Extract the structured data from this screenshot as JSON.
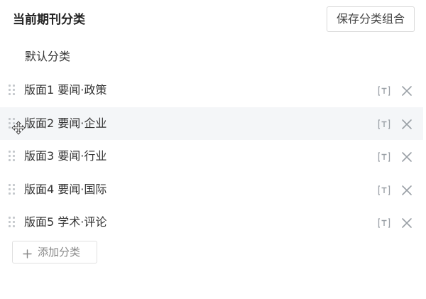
{
  "header": {
    "title": "当前期刊分类",
    "save_label": "保存分类组合"
  },
  "default_category": "默认分类",
  "categories": [
    {
      "label": "版面1 要闻·政策"
    },
    {
      "label": "版面2 要闻·企业"
    },
    {
      "label": "版面3 要闻·行业"
    },
    {
      "label": "版面4 要闻·国际"
    },
    {
      "label": "版面5 学术·评论"
    }
  ],
  "add_button": {
    "label": "添加分类"
  },
  "icons": {
    "drag": "drag-handle-icon",
    "type": "text-type-icon",
    "close": "close-icon",
    "add": "plus-icon",
    "cursor": "move-cursor-icon"
  },
  "colors": {
    "hover_row": "#f4f6f8",
    "icon_gray": "#9aa0a6",
    "border": "#d9d9d9"
  }
}
